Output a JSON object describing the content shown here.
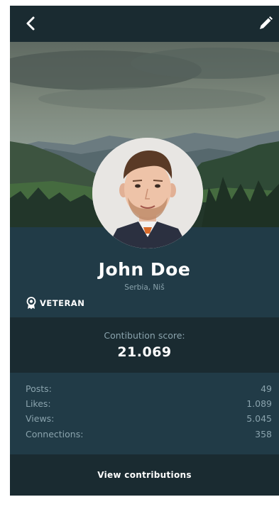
{
  "header": {
    "back_icon": "chevron-left-icon",
    "edit_icon": "pencil-icon"
  },
  "profile": {
    "name": "John Doe",
    "location": "Serbia, Niš",
    "badge": {
      "icon": "award-ribbon-icon",
      "label": "VETERAN"
    }
  },
  "score": {
    "label": "Contibution score:",
    "value": "21.069"
  },
  "stats": [
    {
      "label": "Posts:",
      "value": "49"
    },
    {
      "label": "Likes:",
      "value": "1.089"
    },
    {
      "label": "Views:",
      "value": "5.045"
    },
    {
      "label": "Connections:",
      "value": "358"
    }
  ],
  "footer": {
    "button_label": "View contributions"
  },
  "colors": {
    "dark_bar": "#1a2b31",
    "panel": "#213b47",
    "muted_text": "#8aa3ad",
    "text": "#ffffff"
  }
}
